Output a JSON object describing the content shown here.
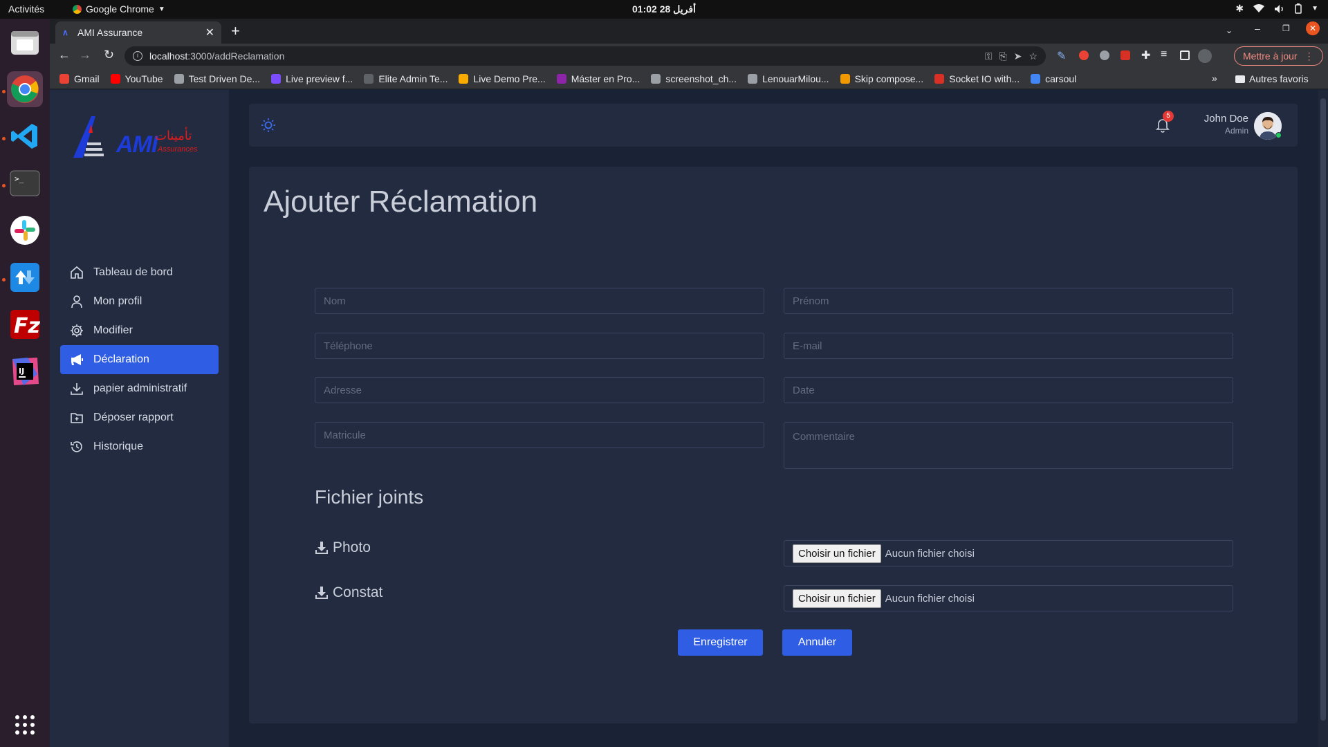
{
  "os": {
    "activities": "Activités",
    "app_name": "Google Chrome",
    "clock": "أفريل 28  01:02"
  },
  "browser": {
    "tab_title": "AMI Assurance",
    "url_host": "localhost",
    "url_path": ":3000/addReclamation",
    "update_label": "Mettre à jour",
    "other_bookmarks": "Autres favoris",
    "bookmarks": [
      {
        "label": "Gmail",
        "color": "#ea4335"
      },
      {
        "label": "YouTube",
        "color": "#ff0000"
      },
      {
        "label": "Test Driven De...",
        "color": "#9aa0a6"
      },
      {
        "label": "Live preview f...",
        "color": "#7c4dff"
      },
      {
        "label": "Elite Admin Te...",
        "color": "#5f6368"
      },
      {
        "label": "Live Demo Pre...",
        "color": "#f9ab00"
      },
      {
        "label": "Máster en Pro...",
        "color": "#8e24aa"
      },
      {
        "label": "screenshot_ch...",
        "color": "#9aa0a6"
      },
      {
        "label": "LenouarMilou...",
        "color": "#9aa0a6"
      },
      {
        "label": "Skip compose...",
        "color": "#f29900"
      },
      {
        "label": "Socket IO with...",
        "color": "#d93025"
      },
      {
        "label": "carsoul",
        "color": "#4285f4"
      }
    ]
  },
  "sidebar": {
    "logo_text": "AMI",
    "logo_sub": "Assurances",
    "logo_arabic": "تأمينات",
    "items": [
      {
        "label": "Tableau de bord",
        "icon": "home-icon"
      },
      {
        "label": "Mon profil",
        "icon": "user-icon"
      },
      {
        "label": "Modifier",
        "icon": "gear-icon"
      },
      {
        "label": "Déclaration",
        "icon": "megaphone-icon"
      },
      {
        "label": "papier administratif",
        "icon": "download-icon"
      },
      {
        "label": "Déposer rapport",
        "icon": "folder-plus-icon"
      },
      {
        "label": "Historique",
        "icon": "history-icon"
      }
    ]
  },
  "header": {
    "user_name": "John Doe",
    "user_role": "Admin",
    "notif_count": "5"
  },
  "form": {
    "title": "Ajouter Réclamation",
    "placeholders": {
      "nom": "Nom",
      "prenom": "Prénom",
      "telephone": "Téléphone",
      "email": "E-mail",
      "adresse": "Adresse",
      "date": "Date",
      "matricule": "Matricule",
      "commentaire": "Commentaire"
    },
    "attachments_title": "Fichier joints",
    "photo_label": "Photo",
    "constat_label": "Constat",
    "choose_file": "Choisir un fichier",
    "no_file": "Aucun fichier choisi",
    "save_label": "Enregistrer",
    "cancel_label": "Annuler"
  },
  "colors": {
    "accent": "#2f5de3",
    "background": "#1a2236",
    "panel": "#222b40"
  }
}
